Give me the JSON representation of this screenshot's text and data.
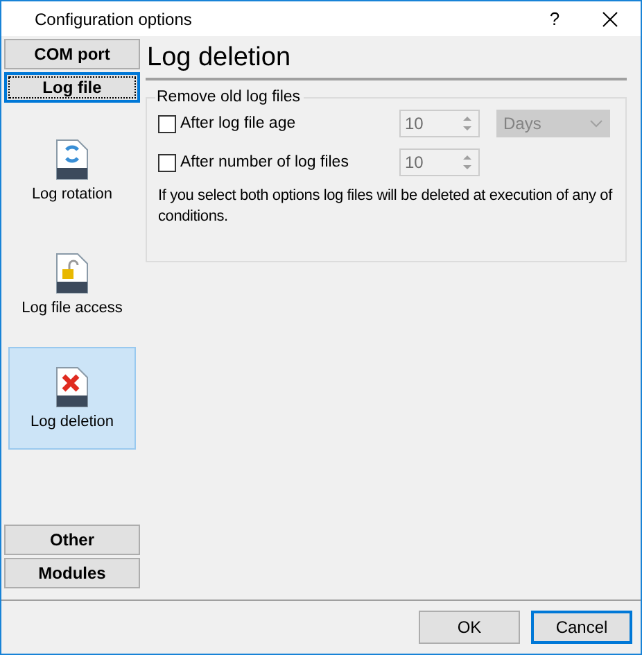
{
  "window": {
    "title": "Configuration options",
    "help": "?"
  },
  "sidebar": {
    "groups_top": [
      {
        "label": "COM port",
        "selected": false
      },
      {
        "label": "Log file",
        "selected": true
      }
    ],
    "items": [
      {
        "label": "Log rotation",
        "kind": "rotation",
        "selected": false
      },
      {
        "label": "Log file access",
        "kind": "lock",
        "selected": false
      },
      {
        "label": "Log deletion",
        "kind": "delete",
        "selected": true
      }
    ],
    "groups_bottom": [
      {
        "label": "Other",
        "selected": false
      },
      {
        "label": "Modules",
        "selected": false
      }
    ]
  },
  "content": {
    "heading": "Log deletion",
    "group": {
      "title": "Remove old log files",
      "options": [
        {
          "kind": "with_unit",
          "label": "After log file age",
          "checked": false,
          "value": "10",
          "disabled": true,
          "unit": "Days"
        },
        {
          "kind": "plain",
          "label": "After number of log files",
          "checked": false,
          "value": "10",
          "disabled": true
        }
      ],
      "note": "If you select both options log files will be deleted at execution of any of conditions."
    }
  },
  "buttons": [
    {
      "label": "OK",
      "focused": false
    },
    {
      "label": "Cancel",
      "focused": true
    }
  ]
}
